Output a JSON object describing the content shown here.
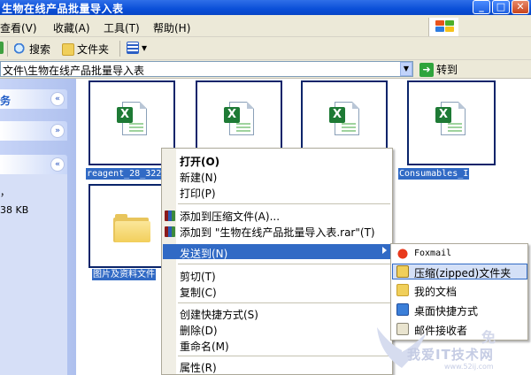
{
  "window": {
    "title": "生物在线产品批量导入表",
    "buttons": {
      "minimize": "_",
      "maximize": "□",
      "close": "✕"
    }
  },
  "menubar": {
    "items": [
      "查看(V)",
      "收藏(A)",
      "工具(T)",
      "帮助(H)"
    ],
    "first_partial": "看"
  },
  "toolbar": {
    "search": "搜索",
    "folders": "文件夹",
    "views": "▾"
  },
  "address": {
    "value": "文件\\生物在线产品批量导入表",
    "go": "转到",
    "go_arrow": "➜"
  },
  "left_panel": {
    "sections": [
      {
        "label": "务",
        "chevron": "«"
      },
      {
        "label": "",
        "chevron": "»"
      },
      {
        "label": "",
        "chevron": "«"
      }
    ],
    "details": {
      "line1": "，",
      "size": "38 KB"
    }
  },
  "files": [
    {
      "name": "reagent_28_322",
      "type": "excel"
    },
    {
      "name": "",
      "type": "excel"
    },
    {
      "name": "",
      "type": "excel"
    },
    {
      "name": "Consumables_I",
      "type": "excel"
    },
    {
      "name": "图片及资料文件",
      "type": "folder"
    }
  ],
  "context_menu": {
    "open": "打开(O)",
    "new": "新建(N)",
    "print": "打印(P)",
    "add_archive": "添加到压缩文件(A)...",
    "add_to_rar": "添加到 \"生物在线产品批量导入表.rar\"(T)",
    "send_to": "发送到(N)",
    "cut": "剪切(T)",
    "copy": "复制(C)",
    "create_shortcut": "创建快捷方式(S)",
    "delete": "删除(D)",
    "rename": "重命名(M)",
    "properties": "属性(R)"
  },
  "send_to_menu": {
    "foxmail": "Foxmail",
    "zipped": "压缩(zipped)文件夹",
    "my_documents": "我的文档",
    "desktop_shortcut": "桌面快捷方式",
    "mail_recipient": "邮件接收者"
  },
  "watermark": {
    "site": "我爱IT技术网",
    "url": "www.52ij.com",
    "char": "免"
  },
  "colors": {
    "title_blue": "#0a4fd8",
    "selection_blue": "#316ac5",
    "excel_green": "#1e7a35",
    "folder_yellow": "#f2cf5b"
  }
}
